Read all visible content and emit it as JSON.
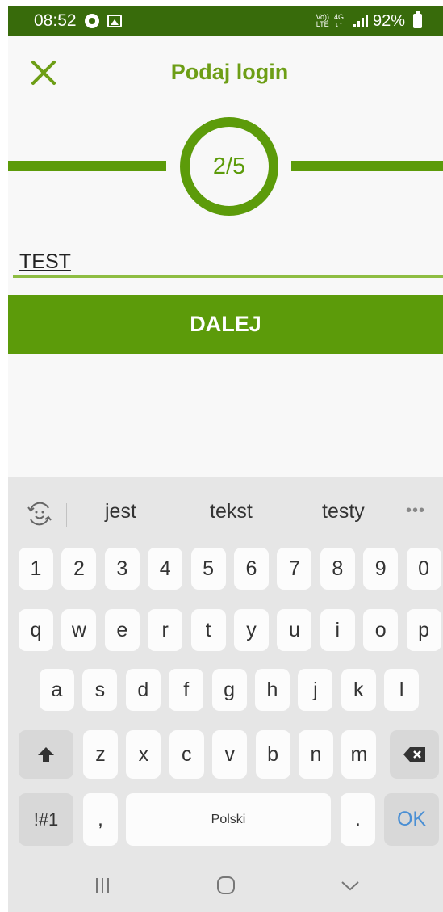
{
  "status_bar": {
    "time": "08:52",
    "network_top": "Vo))",
    "network_bottom": "LTE",
    "data_top": "4G",
    "data_bottom": "↓↑",
    "battery": "92%"
  },
  "header": {
    "title": "Podaj login",
    "close_icon": "close-icon"
  },
  "progress": {
    "step_label": "2/5",
    "current": 2,
    "total": 5
  },
  "form": {
    "login_value": "TEST",
    "next_label": "DALEJ"
  },
  "keyboard": {
    "suggestions": [
      "jest",
      "tekst",
      "testy"
    ],
    "row_numbers": [
      "1",
      "2",
      "3",
      "4",
      "5",
      "6",
      "7",
      "8",
      "9",
      "0"
    ],
    "row_1": [
      "q",
      "w",
      "e",
      "r",
      "t",
      "y",
      "u",
      "i",
      "o",
      "p"
    ],
    "row_2": [
      "a",
      "s",
      "d",
      "f",
      "g",
      "h",
      "j",
      "k",
      "l"
    ],
    "row_3": [
      "z",
      "x",
      "c",
      "v",
      "b",
      "n",
      "m"
    ],
    "symbols_label": "!#1",
    "comma_label": ",",
    "space_label": "Polski",
    "period_label": ".",
    "ok_label": "OK"
  },
  "colors": {
    "status_bar": "#386b0b",
    "brand_green": "#5c9b0a",
    "title_green": "#6d9e16",
    "ok_blue": "#4a8fd4"
  }
}
